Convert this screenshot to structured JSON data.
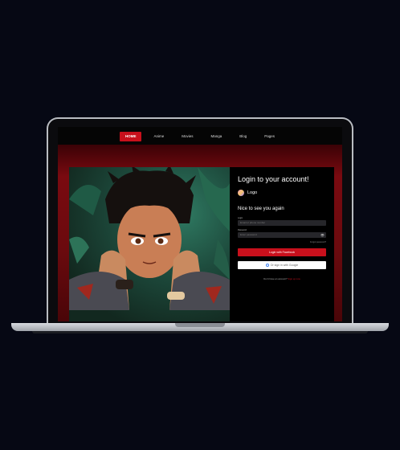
{
  "nav": {
    "items": [
      "HOME",
      "Anime",
      "Movies",
      "Manga",
      "Blog",
      "Pages"
    ],
    "active_index": 0
  },
  "form": {
    "title": "Login to your account!",
    "logo_text": "Logo",
    "greeting": "Nice to see you again",
    "login_label": "Login",
    "login_placeholder": "Email or phone number",
    "password_label": "Password",
    "password_placeholder": "Enter password",
    "forgot": "Forgot password?",
    "facebook_button": "Login with Facebook",
    "google_button": "Or sign in with Google",
    "signup_prompt": "Don't have an account?",
    "signup_link": "Sign up now"
  },
  "colors": {
    "accent": "#c8101c",
    "background": "#060814"
  }
}
